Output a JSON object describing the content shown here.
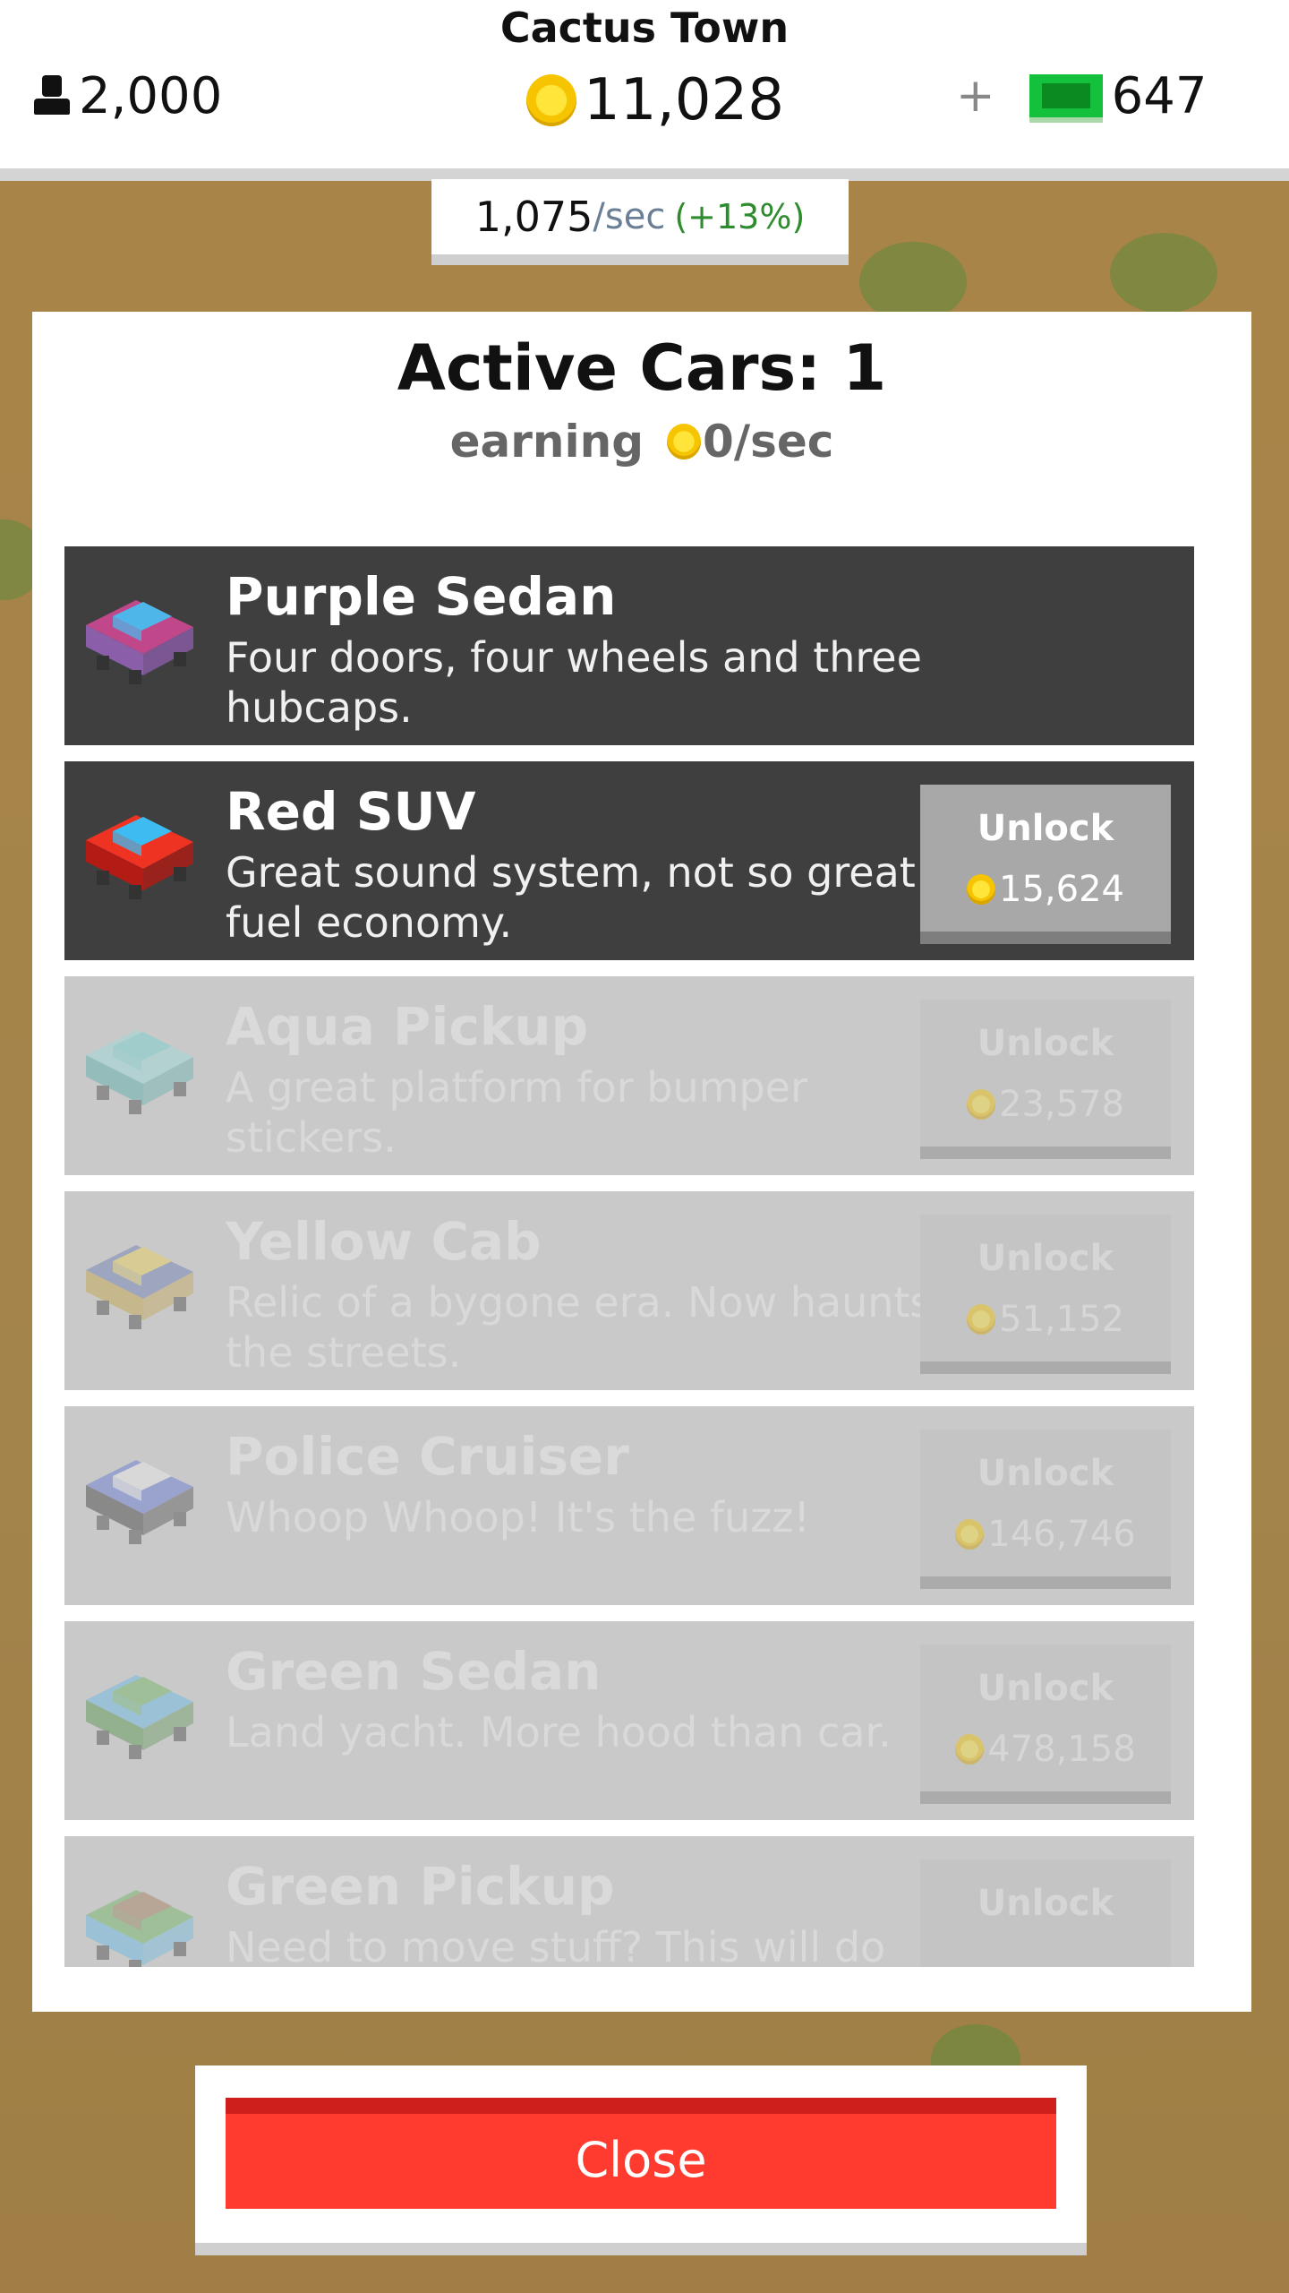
{
  "header": {
    "town_name": "Cactus Town",
    "population": "2,000",
    "coins": "11,028",
    "plus": "+",
    "cash": "647",
    "rate_value": "1,075",
    "rate_unit": "/sec",
    "rate_bonus": "(+13%)"
  },
  "panel": {
    "title": "Active Cars: 1",
    "earning_label": "earning",
    "earning_value": "0/sec"
  },
  "cars": [
    {
      "name": "Purple Sedan",
      "desc": "Four doors, four wheels and three hubcaps.",
      "state": "owned",
      "colors": [
        "#4fb6ea",
        "#c0478a",
        "#8a5ea8"
      ]
    },
    {
      "name": "Red SUV",
      "desc": "Great sound system, not so great fuel economy.",
      "unlock_label": "Unlock",
      "price": "15,624",
      "state": "available",
      "colors": [
        "#3cbcf0",
        "#ef3322",
        "#b21c15"
      ]
    },
    {
      "name": "Aqua Pickup",
      "desc": "A great platform for bumper stickers.",
      "unlock_label": "Unlock",
      "price": "23,578",
      "state": "locked",
      "colors": [
        "#5fd2cf",
        "#8fe0dc",
        "#3fa9a5"
      ]
    },
    {
      "name": "Yellow Cab",
      "desc": "Relic of a bygone era. Now haunts the streets.",
      "unlock_label": "Unlock",
      "price": "51,152",
      "state": "locked",
      "colors": [
        "#f2cf3f",
        "#5a6fb0",
        "#c39a2a"
      ]
    },
    {
      "name": "Police Cruiser",
      "desc": "Whoop Whoop! It's the fuzz!",
      "unlock_label": "Unlock",
      "price": "146,746",
      "state": "locked",
      "colors": [
        "#f2f2f2",
        "#4f67d8",
        "#222222"
      ]
    },
    {
      "name": "Green Sedan",
      "desc": "Land yacht. More hood than car.",
      "unlock_label": "Unlock",
      "price": "478,158",
      "state": "locked",
      "colors": [
        "#5ab04a",
        "#4fb6ea",
        "#3c8a34"
      ]
    },
    {
      "name": "Green Pickup",
      "desc": "Need to move stuff? This will do the",
      "unlock_label": "Unlock",
      "state": "locked",
      "colors": [
        "#9b6b43",
        "#5ab04a",
        "#4fb6ea"
      ]
    }
  ],
  "close_label": "Close"
}
